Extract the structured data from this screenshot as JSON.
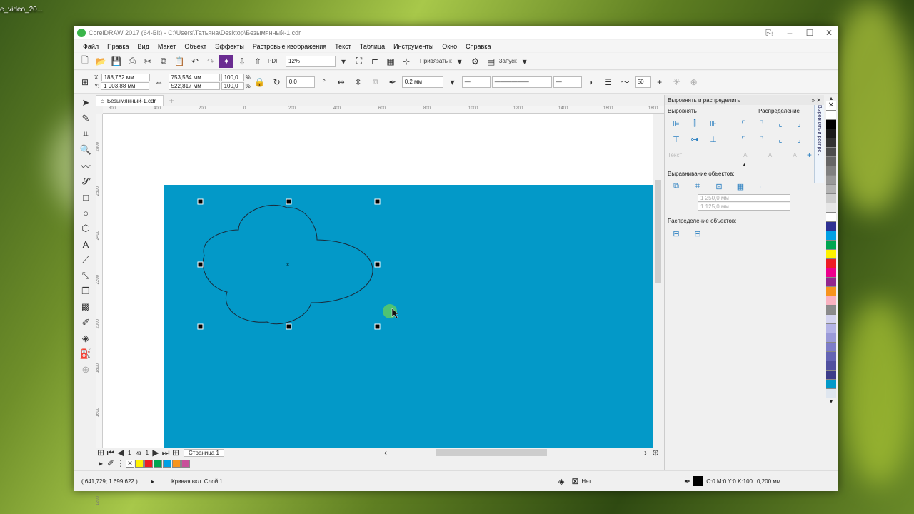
{
  "desktop": {
    "label": "e_video_20..."
  },
  "window": {
    "title": "CorelDRAW 2017 (64-Bit) - C:\\Users\\Татьяна\\Desktop\\Безымянный-1.cdr"
  },
  "menu": [
    "Файл",
    "Правка",
    "Вид",
    "Макет",
    "Объект",
    "Эффекты",
    "Растровые изображения",
    "Текст",
    "Таблица",
    "Инструменты",
    "Окно",
    "Справка"
  ],
  "standard_toolbar": {
    "zoom": "12%",
    "snap_label": "Привязать к",
    "launch_label": "Запуск",
    "pdf_label": "PDF"
  },
  "property_bar": {
    "x_label": "X:",
    "y_label": "Y:",
    "x": "188,762 мм",
    "y": "1 903,88 мм",
    "width": "753,534 мм",
    "height": "522,817 мм",
    "scale_w": "100,0",
    "scale_h": "100,0",
    "percent": "%",
    "angle": "0,0",
    "outline_width": "0,2 мм",
    "smoothing": "50"
  },
  "document": {
    "tab_name": "Безымянный-1.cdr",
    "ruler_h": [
      "800",
      "400",
      "200",
      "0",
      "200",
      "400",
      "600",
      "800",
      "1000",
      "1200",
      "1400",
      "1600",
      "1800"
    ],
    "ruler_v": [
      "2800",
      "2600",
      "2400",
      "2200",
      "2000",
      "1800",
      "1600",
      "1400",
      "1200"
    ]
  },
  "page_nav": {
    "current": "1",
    "of": "из",
    "total": "1",
    "page_tab": "Страница 1"
  },
  "docker": {
    "title": "Выровнять и распределить",
    "align_label": "Выровнять",
    "distribute_label": "Распределение",
    "text_label": "Текст",
    "align_objects_label": "Выравнивание объектов:",
    "coord_x": "1 250,0 мм",
    "coord_y": "1 125,0 мм",
    "distribute_objects_label": "Распределение объектов:",
    "vertical_tab": "Выровнять и распре..."
  },
  "status": {
    "coords": "( 641,729; 1 699,622 )",
    "object_info": "Кривая вкл. Слой 1",
    "fill_label": "Нет",
    "outline_color": "C:0 M:0 Y:0 K:100",
    "outline_width": "0,200 мм"
  },
  "colors": {
    "page_fill": "#0399c8",
    "palette": [
      "#ffffff",
      "#000000",
      "#1a1a1a",
      "#333333",
      "#4d4d4d",
      "#666666",
      "#808080",
      "#999999",
      "#b3b3b3",
      "#cccccc",
      "#e6e6e6",
      "#ffffff",
      "#2e3192",
      "#00a0e4",
      "#00a651",
      "#fff200",
      "#ed1c24",
      "#ec008c",
      "#92278f",
      "#f7941d",
      "#f9b2c0",
      "#8c8c8c",
      "#d4d4f0",
      "#b4b4e6",
      "#9a9ad8",
      "#7d7dc8",
      "#6464b4",
      "#50509f",
      "#3c3c8a",
      "#0399c8",
      "#dfe6ef"
    ],
    "doc_palette": [
      "#fff200",
      "#ed1c24",
      "#00a651",
      "#00a0e4",
      "#f7941d",
      "#c8509a"
    ]
  }
}
